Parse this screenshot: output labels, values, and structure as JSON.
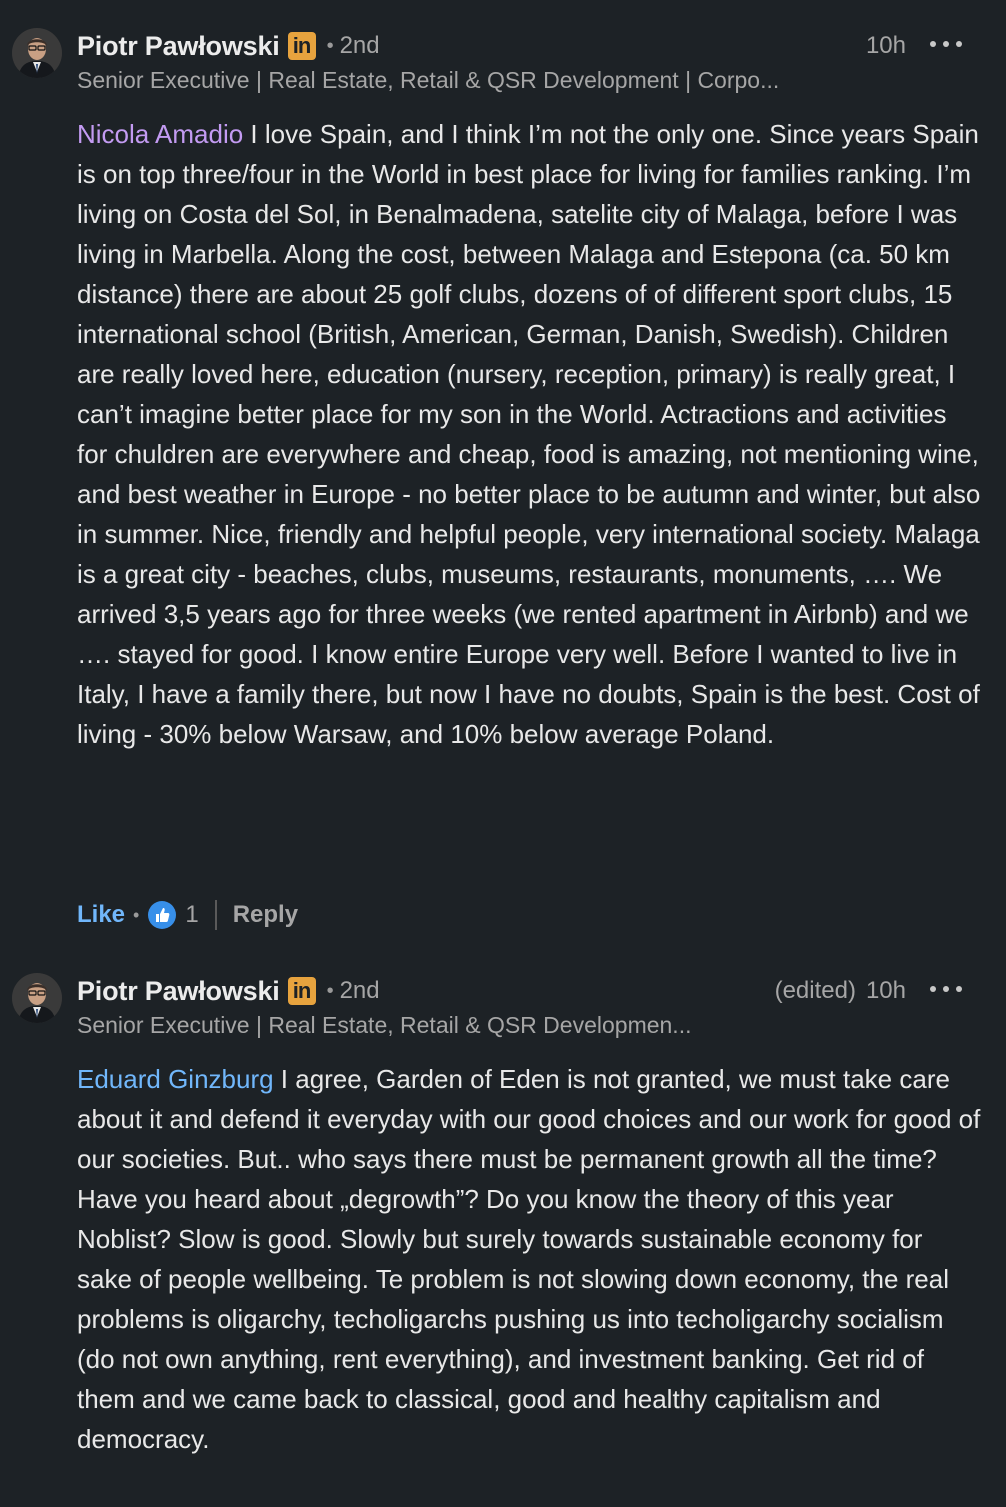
{
  "comments": [
    {
      "author": "Piotr Pawłowski",
      "badge": "in",
      "degree": "2nd",
      "edited": "",
      "time": "10h",
      "headline": "Senior Executive | Real Estate, Retail & QSR Development | Corpo...",
      "mention": "Nicola Amadio",
      "text": " I love Spain, and I think I’m not the only one. Since years Spain is on top three/four in the World in best place for living for families ranking. I’m living on Costa del Sol, in Benalmadena, satelite city of Malaga, before I was living in Marbella. Along the cost, between Malaga and Estepona (ca. 50 km distance) there are about 25 golf clubs, dozens of of different sport clubs, 15 international school (British, American, German, Danish, Swedish). Children are really loved here, education (nursery, reception, primary) is really great, I can’t imagine better place for my son in the World. Actractions and activities for chuldren are everywhere and cheap, food is amazing, not mentioning wine, and best weather in Europe - no better place to be autumn and winter, but also in summer. Nice, friendly and helpful people, very international society. Malaga is a great city - beaches, clubs, museums, restaurants, monuments, …. We arrived 3,5 years ago for three weeks (we rented apartment in Airbnb) and we …. stayed for good. I know entire Europe very well. Before I wanted to live in Italy, I have a family there, but now I have no doubts, Spain is the best. Cost of living - 30% below Warsaw, and 10% below average Poland.",
      "like_label": "Like",
      "reaction_count": "1",
      "reply_label": "Reply"
    },
    {
      "author": "Piotr Pawłowski",
      "badge": "in",
      "degree": "2nd",
      "edited": "(edited)",
      "time": "10h",
      "headline": "Senior Executive | Real Estate, Retail & QSR Developmen...",
      "mention": "Eduard Ginzburg",
      "text": " I agree, Garden of Eden is not granted, we must take care about it and defend it everyday with our good choices and our work for good of our societies. But.. who says there must be permanent growth all the time? Have you heard about „degrowth”? Do you know the theory of this year Noblist? Slow is good. Slowly but surely towards sustainable economy for sake of people wellbeing. Te problem is not slowing down economy, the real problems is oligarchy, techoligarchs pushing us into techoligarchy socialism (do not own anything, rent everything), and investment banking. Get rid of them and we came back to classical, good and healthy capitalism and democracy."
    }
  ],
  "icons": {
    "more": "more-horizontal-icon",
    "reaction": "thumbs-up-reaction-icon",
    "badge": "linkedin-premium-badge-icon"
  },
  "colors": {
    "background": "#1d2226",
    "mention_purple": "#c39bf2",
    "mention_blue": "#71b7fb",
    "like_blue": "#71b7fb",
    "badge_gold": "#e7a33e"
  }
}
